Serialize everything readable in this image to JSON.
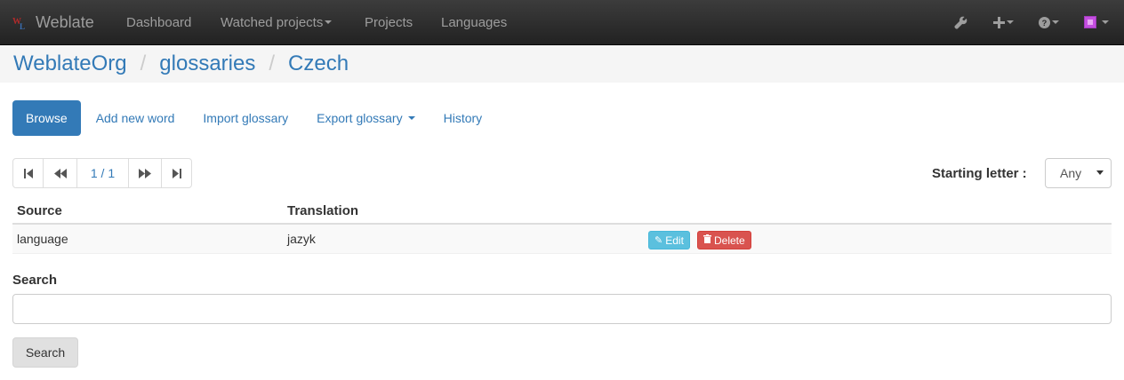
{
  "navbar": {
    "brand": "Weblate",
    "items": [
      {
        "label": "Dashboard"
      },
      {
        "label": "Watched projects"
      },
      {
        "label": "Projects"
      },
      {
        "label": "Languages"
      }
    ],
    "icons": [
      "wrench-icon",
      "plus-icon",
      "help-icon",
      "avatar"
    ]
  },
  "breadcrumb": {
    "items": [
      "WeblateOrg",
      "glossaries",
      "Czech"
    ],
    "separator": "/"
  },
  "tabs": [
    {
      "label": "Browse",
      "active": true
    },
    {
      "label": "Add new word"
    },
    {
      "label": "Import glossary"
    },
    {
      "label": "Export glossary"
    },
    {
      "label": "History"
    }
  ],
  "pager": {
    "page": "1 / 1"
  },
  "filter": {
    "label": "Starting letter :",
    "selected": "Any"
  },
  "table": {
    "headers": [
      "Source",
      "Translation"
    ],
    "rows": [
      {
        "source": "language",
        "translation": "jazyk"
      }
    ],
    "actions": {
      "edit": "Edit",
      "delete": "Delete"
    }
  },
  "search": {
    "label": "Search",
    "value": "",
    "button": "Search"
  },
  "colors": {
    "navbar": "#222222",
    "link": "#337ab7",
    "edit": "#5bc0de",
    "delete": "#d9534f"
  }
}
